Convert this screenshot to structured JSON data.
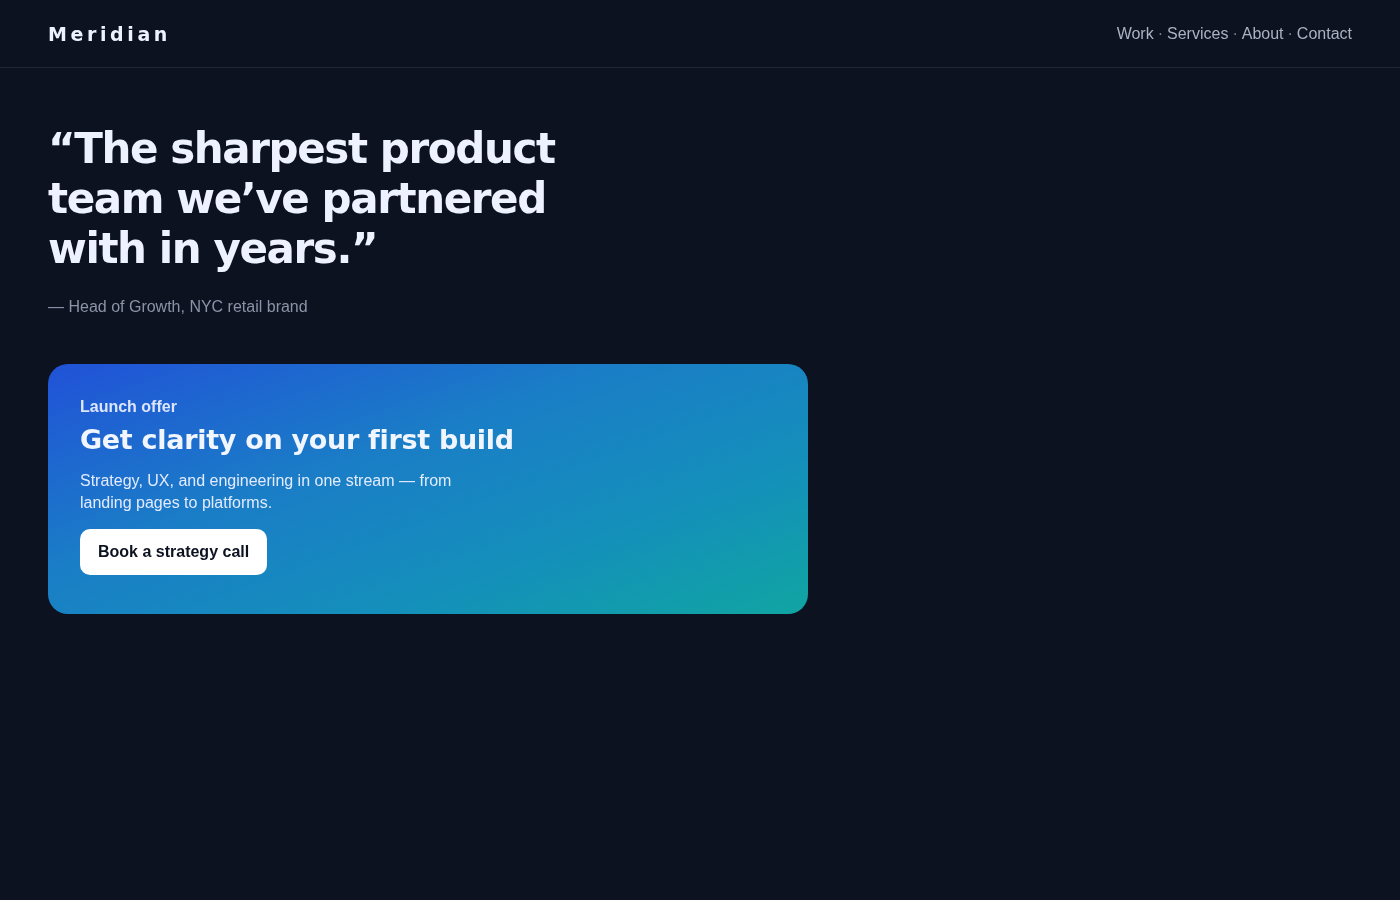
{
  "header": {
    "logo": "Meridian",
    "nav": [
      {
        "kind": "link",
        "label": "Work"
      },
      {
        "kind": "separator",
        "label": "·"
      },
      {
        "kind": "link",
        "label": "Services"
      },
      {
        "kind": "separator",
        "label": "·"
      },
      {
        "kind": "link",
        "label": "About"
      },
      {
        "kind": "separator",
        "label": "·"
      },
      {
        "kind": "link",
        "label": "Contact"
      }
    ]
  },
  "testimonial": {
    "quote": "“The sharpest product team we’ve partnered with in years.”",
    "attribution": "— Head of Growth, NYC retail brand"
  },
  "offer_card": {
    "eyebrow": "Launch offer",
    "title": "Get clarity on your first build",
    "description": "Strategy, UX, and engineering in one stream — from landing pages to platforms.",
    "button": "Book a strategy call"
  }
}
